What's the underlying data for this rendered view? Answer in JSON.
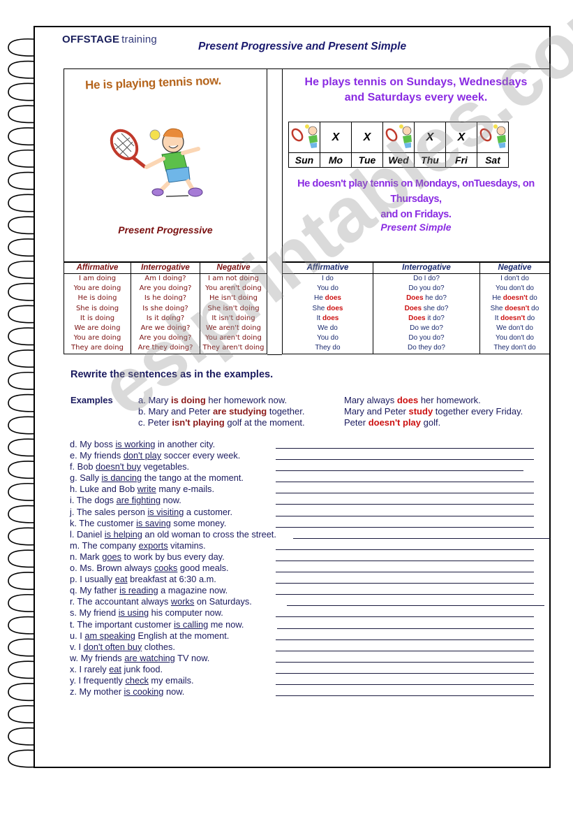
{
  "header": {
    "logo_brand": "OFFSTAGE",
    "logo_suffix": "training",
    "title": "Present Progressive and Present Simple"
  },
  "progressive_panel": {
    "caption": "He is playing tennis now.",
    "label": "Present Progressive",
    "image": "boy-playing-tennis"
  },
  "simple_panel": {
    "caption_line1": "He plays tennis on Sundays, Wednesdays",
    "caption_line2": "and Saturdays every week.",
    "week": [
      {
        "day": "Sun",
        "plays": true,
        "mark": ""
      },
      {
        "day": "Mo",
        "plays": false,
        "mark": "X"
      },
      {
        "day": "Tue",
        "plays": false,
        "mark": "X"
      },
      {
        "day": "Wed",
        "plays": true,
        "mark": ""
      },
      {
        "day": "Thu",
        "plays": false,
        "mark": "X"
      },
      {
        "day": "Fri",
        "plays": false,
        "mark": "X"
      },
      {
        "day": "Sat",
        "plays": true,
        "mark": ""
      }
    ],
    "negative_line1": "He doesn't play tennis on Mondays, onTuesdays, on Thursdays,",
    "negative_line2": "and on Fridays.",
    "label": "Present Simple"
  },
  "progressive_table": {
    "headers": [
      "Affirmative",
      "Interrogative",
      "Negative"
    ],
    "rows": [
      [
        "I am doing",
        "Am I doing?",
        "I am not doing"
      ],
      [
        "You are doing",
        "Are you doing?",
        "You aren't doing"
      ],
      [
        "He is doing",
        "Is he doing?",
        "He isn't doing"
      ],
      [
        "She is doing",
        "Is she doing?",
        "She isn't doing"
      ],
      [
        "It is doing",
        "Is it doing?",
        "It isn't doing"
      ],
      [
        "We are doing",
        "Are we doing?",
        "We aren't doing"
      ],
      [
        "You are doing",
        "Are you doing?",
        "You aren't doing"
      ],
      [
        "They are doing",
        "Are they doing?",
        "They aren't doing"
      ]
    ]
  },
  "simple_table": {
    "headers": [
      "Affirmative",
      "Interrogative",
      "Negative"
    ],
    "rows": [
      [
        {
          "pre": "I do",
          "hl": "",
          "post": ""
        },
        {
          "pre": "",
          "hl": "",
          "post": "Do I do?"
        },
        {
          "pre": "I don't do",
          "hl": "",
          "post": ""
        }
      ],
      [
        {
          "pre": "You do",
          "hl": "",
          "post": ""
        },
        {
          "pre": "",
          "hl": "",
          "post": "Do you do?"
        },
        {
          "pre": "You don't do",
          "hl": "",
          "post": ""
        }
      ],
      [
        {
          "pre": "He ",
          "hl": "does",
          "post": ""
        },
        {
          "pre": "",
          "hl": "Does",
          "post": " he do?"
        },
        {
          "pre": "He ",
          "hl": "doesn't",
          "post": " do"
        }
      ],
      [
        {
          "pre": "She ",
          "hl": "does",
          "post": ""
        },
        {
          "pre": "",
          "hl": "Does",
          "post": " she do?"
        },
        {
          "pre": "She ",
          "hl": "doesn't",
          "post": " do"
        }
      ],
      [
        {
          "pre": "It ",
          "hl": "does",
          "post": ""
        },
        {
          "pre": "",
          "hl": "Does",
          "post": " it do?"
        },
        {
          "pre": "It ",
          "hl": "doesn't",
          "post": " do"
        }
      ],
      [
        {
          "pre": "We do",
          "hl": "",
          "post": ""
        },
        {
          "pre": "",
          "hl": "",
          "post": "Do we do?"
        },
        {
          "pre": "We don't do",
          "hl": "",
          "post": ""
        }
      ],
      [
        {
          "pre": "You do",
          "hl": "",
          "post": ""
        },
        {
          "pre": "",
          "hl": "",
          "post": "Do you do?"
        },
        {
          "pre": "You don't do",
          "hl": "",
          "post": ""
        }
      ],
      [
        {
          "pre": "They do",
          "hl": "",
          "post": ""
        },
        {
          "pre": "",
          "hl": "",
          "post": "Do they do?"
        },
        {
          "pre": "They don't do",
          "hl": "",
          "post": ""
        }
      ]
    ]
  },
  "exercise": {
    "instruction": "Rewrite the sentences as in the examples.",
    "examples_label": "Examples",
    "examples": [
      {
        "left": {
          "pre": "a. Mary ",
          "hl": "is doing",
          "post": " her homework now."
        },
        "right": {
          "pre": "Mary always ",
          "hl": "does",
          "post": " her homework."
        }
      },
      {
        "left": {
          "pre": "b. Mary and Peter ",
          "hl": "are studying",
          "post": " together."
        },
        "right": {
          "pre": "Mary and Peter ",
          "hl": "study",
          "post": " together every Friday."
        }
      },
      {
        "left": {
          "pre": "c. Peter ",
          "hl": "isn't playing",
          "post": " golf at the moment."
        },
        "right": {
          "pre": "Peter ",
          "hl": "doesn't play",
          "post": " golf."
        }
      }
    ],
    "items": [
      {
        "pre": "d. My boss ",
        "u": "is working",
        "post": " in another city.",
        "answer": ""
      },
      {
        "pre": "e. My friends ",
        "u": "don't play",
        "post": " soccer every week.",
        "answer": ""
      },
      {
        "pre": "f. Bob ",
        "u": "doesn't buy",
        "post": " vegetables.",
        "answer": ""
      },
      {
        "pre": "g. Sally ",
        "u": "is dancing",
        "post": " the tango at the moment.",
        "answer": ""
      },
      {
        "pre": "h. Luke and Bob ",
        "u": "write",
        "post": " many e-mails.",
        "answer": ""
      },
      {
        "pre": "i. The dogs ",
        "u": "are fighting",
        "post": " now.",
        "answer": ""
      },
      {
        "pre": "j. The sales person ",
        "u": "is visiting",
        "post": " a customer.",
        "answer": ""
      },
      {
        "pre": "k. The customer ",
        "u": "is saving",
        "post": " some money.",
        "answer": ""
      },
      {
        "pre": "l. Daniel ",
        "u": "is helping",
        "post": " an old woman to cross the street.",
        "answer": ""
      },
      {
        "pre": "m. The company ",
        "u": "exports",
        "post": " vitamins.",
        "answer": ""
      },
      {
        "pre": "n. Mark ",
        "u": "goes",
        "post": " to work by bus every day.",
        "answer": ""
      },
      {
        "pre": "o. Ms. Brown always ",
        "u": "cooks",
        "post": " good meals.",
        "answer": ""
      },
      {
        "pre": "p. I usually ",
        "u": "eat",
        "post": " breakfast at 6:30 a.m.",
        "answer": ""
      },
      {
        "pre": "q. My father ",
        "u": "is reading",
        "post": " a magazine now.",
        "answer": ""
      },
      {
        "pre": "r. The accountant always ",
        "u": "works",
        "post": " on Saturdays.",
        "answer": ""
      },
      {
        "pre": "s. My friend ",
        "u": "is using",
        "post": " his computer now.",
        "answer": ""
      },
      {
        "pre": "t. The important customer ",
        "u": "is calling",
        "post": " me now.",
        "answer": ""
      },
      {
        "pre": "u. I ",
        "u": "am speaking",
        "post": " English at the moment.",
        "answer": ""
      },
      {
        "pre": "v. I ",
        "u": "don't often buy",
        "post": " clothes.",
        "answer": ""
      },
      {
        "pre": "w. My friends ",
        "u": "are watching",
        "post": " TV now.",
        "answer": ""
      },
      {
        "pre": "x. I rarely ",
        "u": "eat",
        "post": " junk food.",
        "answer": ""
      },
      {
        "pre": "y. I frequently ",
        "u": "check",
        "post": " my emails.",
        "answer": ""
      },
      {
        "pre": "z. My mother ",
        "u": "is cooking",
        "post": " now.",
        "answer": ""
      }
    ]
  },
  "watermark": "eslprintables.com",
  "colors": {
    "navy": "#1a1a5e",
    "maroon": "#7a1010",
    "purple": "#8a2be2",
    "red": "#cc1111",
    "orange": "#b5651d"
  }
}
